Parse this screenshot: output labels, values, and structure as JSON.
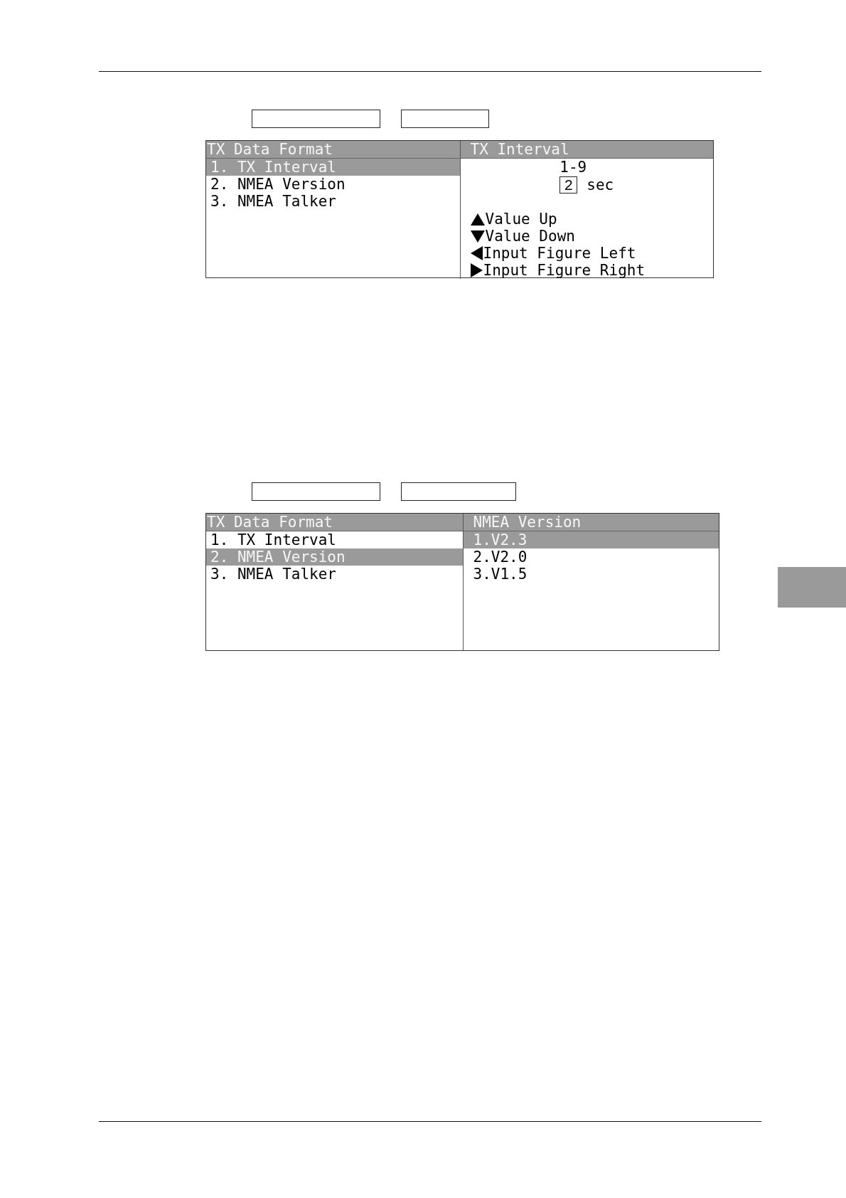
{
  "page": {
    "edge_tab": true,
    "figures": [
      {
        "keys": [
          {
            "kind": "blank"
          },
          {
            "kind": "blank"
          }
        ],
        "menu": {
          "title": "TX Data Format",
          "items": [
            {
              "label": "1. TX Interval",
              "selected": true
            },
            {
              "label": "2. NMEA Version",
              "selected": false
            },
            {
              "label": "3. NMEA Talker",
              "selected": false
            }
          ]
        },
        "panel": {
          "kind": "numeric_input",
          "title": "TX Interval",
          "range": "1-9",
          "value": "2",
          "unit": "sec",
          "hints": [
            {
              "kind": "up",
              "label": "Value Up"
            },
            {
              "kind": "down",
              "label": "Value Down"
            },
            {
              "kind": "left",
              "label": "Input Figure Left"
            },
            {
              "kind": "right",
              "label": "Input Figure Right"
            }
          ]
        }
      },
      {
        "keys": [
          {
            "kind": "blank"
          },
          {
            "kind": "blank"
          }
        ],
        "menu": {
          "title": "TX Data Format",
          "items": [
            {
              "label": "1. TX Interval",
              "selected": false
            },
            {
              "label": "2. NMEA Version",
              "selected": true
            },
            {
              "label": "3. NMEA Talker",
              "selected": false
            }
          ]
        },
        "panel": {
          "kind": "option_list",
          "title": "NMEA Version",
          "options": [
            {
              "label": "1.V2.3",
              "selected": true
            },
            {
              "label": "2.V2.0",
              "selected": false
            },
            {
              "label": "3.V1.5",
              "selected": false
            }
          ]
        }
      }
    ]
  }
}
